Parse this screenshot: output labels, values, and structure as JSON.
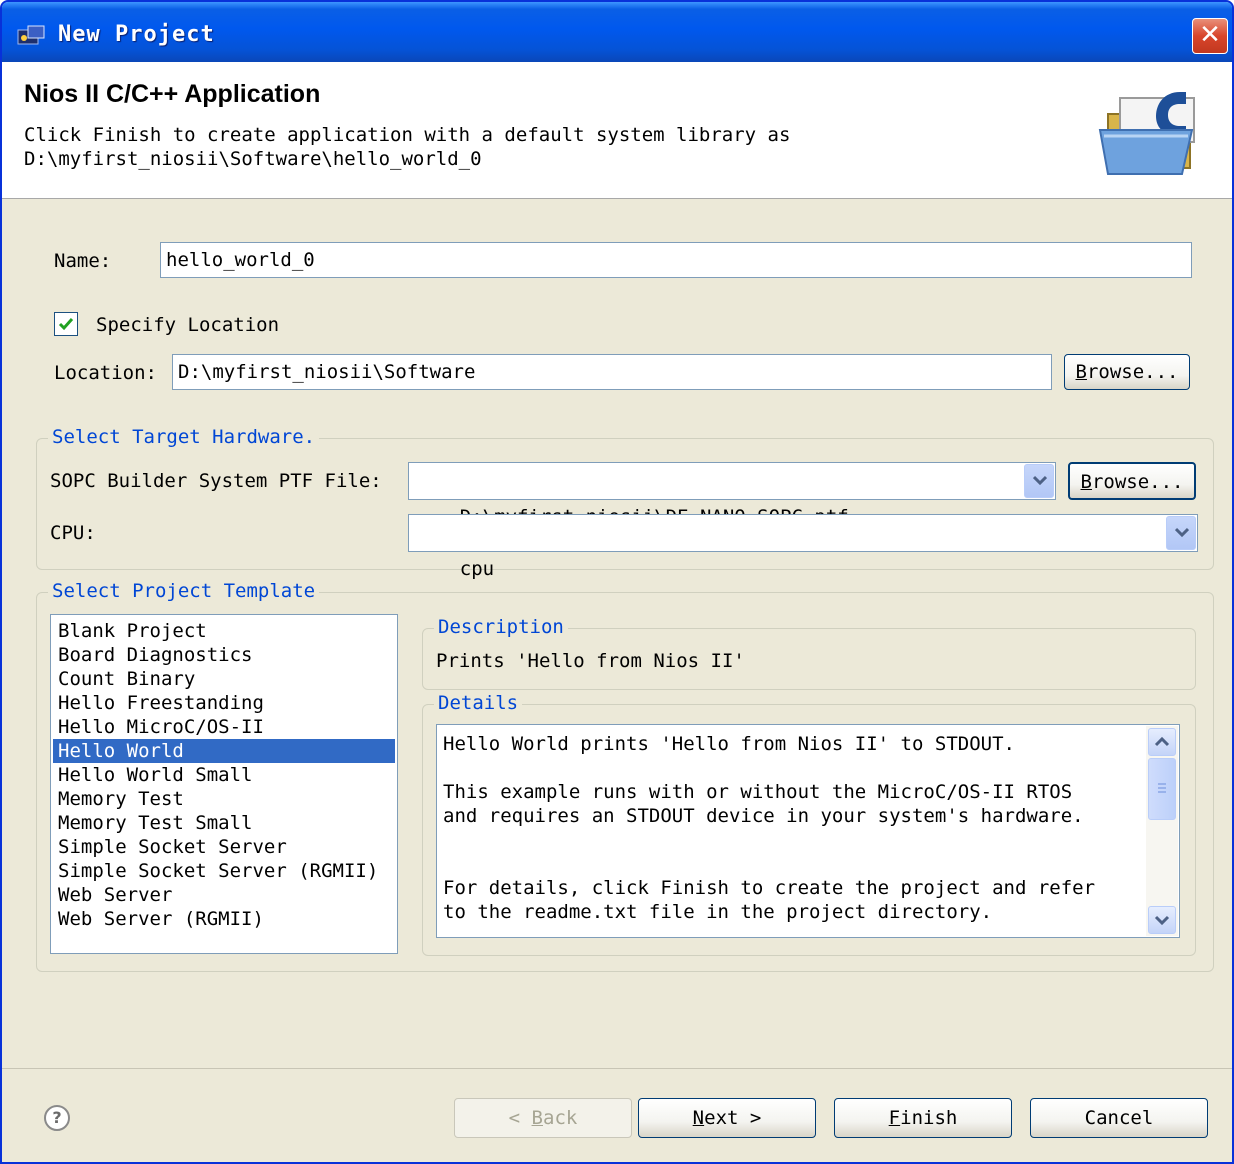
{
  "window": {
    "title": "New Project"
  },
  "banner": {
    "heading": "Nios II C/C++ Application",
    "message_line1": "Click Finish to create application with a default system library as",
    "message_line2": "D:\\myfirst_niosii\\Software\\hello_world_0"
  },
  "form": {
    "name_label": "Name:",
    "name_value": "hello_world_0",
    "specify_location_label": "Specify Location",
    "specify_location_checked": true,
    "location_label": "Location:",
    "location_value": "D:\\myfirst_niosii\\Software",
    "location_browse": {
      "mnemonic": "B",
      "rest": "rowse..."
    }
  },
  "target_hardware": {
    "group_label": "Select Target Hardware.",
    "ptf_label": "SOPC Builder System PTF File:",
    "ptf_value": "D:\\myfirst_niosii\\DE_NANO_SOPC.ptf",
    "ptf_browse": {
      "mnemonic": "B",
      "rest": "rowse..."
    },
    "cpu_label": "CPU:",
    "cpu_value": "cpu"
  },
  "template": {
    "group_label": "Select Project Template",
    "items": [
      "Blank Project",
      "Board Diagnostics",
      "Count Binary",
      "Hello Freestanding",
      "Hello MicroC/OS-II",
      "Hello World",
      "Hello World Small",
      "Memory Test",
      "Memory Test Small",
      "Simple Socket Server",
      "Simple Socket Server (RGMII)",
      "Web Server",
      "Web Server (RGMII)"
    ],
    "selected_index": 5,
    "description_label": "Description",
    "description_text": "Prints 'Hello from Nios II'",
    "details_label": "Details",
    "details_lines": [
      "Hello World prints 'Hello from Nios II' to STDOUT.",
      "",
      "This example runs with or without the MicroC/OS-II RTOS",
      "and requires an STDOUT device in your system's hardware.",
      "",
      "",
      "For details, click Finish to create the project and refer",
      "to the readme.txt file in the project directory."
    ]
  },
  "buttons": {
    "back": {
      "prefix": "< ",
      "mnemonic": "B",
      "rest": "ack",
      "enabled": false
    },
    "next": {
      "mnemonic": "N",
      "rest": "ext >"
    },
    "finish": {
      "mnemonic": "F",
      "rest": "inish"
    },
    "cancel": "Cancel"
  },
  "colors": {
    "title_bar": "#0058ee",
    "dialog_bg": "#ece9d8",
    "group_label": "#0046d5",
    "selection": "#316ac5",
    "checkbox_mark": "#21a121",
    "field_border": "#7f9db9"
  },
  "icons": [
    "app-icon",
    "close-icon",
    "folder-c-icon",
    "checkbox-checked-icon",
    "chevron-down-icon",
    "scroll-up-icon",
    "scroll-down-icon",
    "help-icon"
  ]
}
